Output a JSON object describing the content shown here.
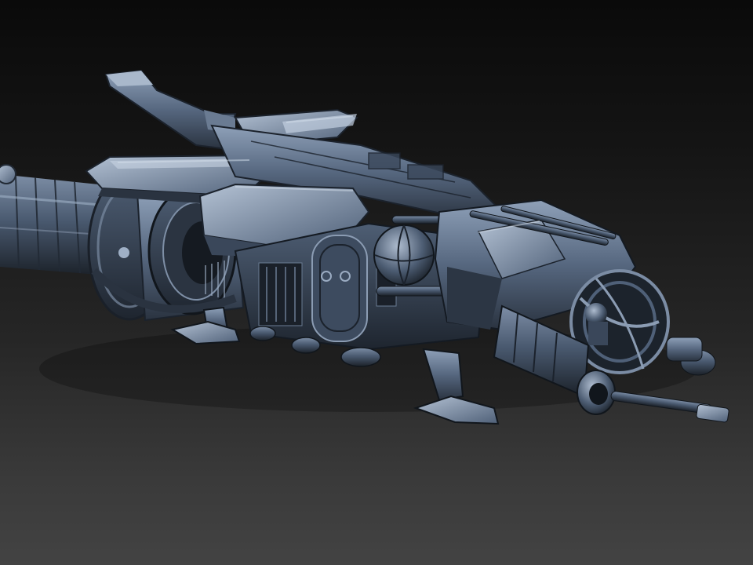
{
  "scene": {
    "subject": "sculpted-3d-gunship-model",
    "background_top_color": "#0a0a0a",
    "background_bottom_color": "#434343",
    "material_base_color": "#4a5b72",
    "material_highlight_color": "#aab8cc",
    "material_shadow_color": "#1b222c"
  }
}
